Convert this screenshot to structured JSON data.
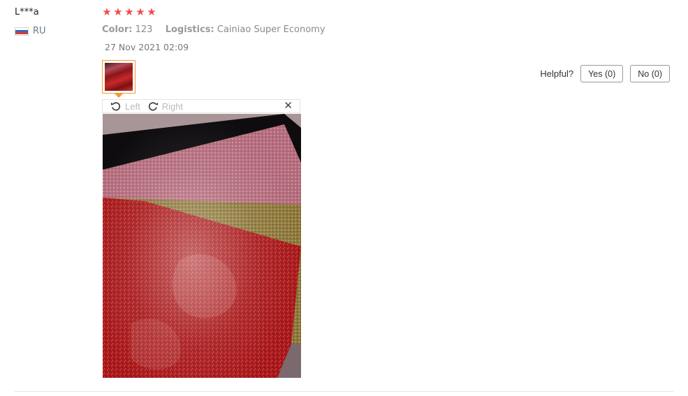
{
  "review": {
    "user": "L***a",
    "country_code": "RU",
    "rating_stars": 5,
    "attributes": [
      {
        "key": "Color:",
        "value": "123"
      },
      {
        "key": "Logistics:",
        "value": "Cainiao Super Economy"
      }
    ],
    "date": "27 Nov 2021 02:09"
  },
  "helpful": {
    "label": "Helpful?",
    "yes_label": "Yes (0)",
    "no_label": "No (0)"
  },
  "viewer": {
    "rotate_left_label": "Left",
    "rotate_right_label": "Right",
    "close_glyph": "✕"
  },
  "colors": {
    "star": "#ee4c4e",
    "thumb_border": "#f39c2b"
  },
  "icons": {
    "rotate_left": "rotate-left-icon",
    "rotate_right": "rotate-right-icon",
    "close": "close-icon",
    "star": "star-icon"
  }
}
